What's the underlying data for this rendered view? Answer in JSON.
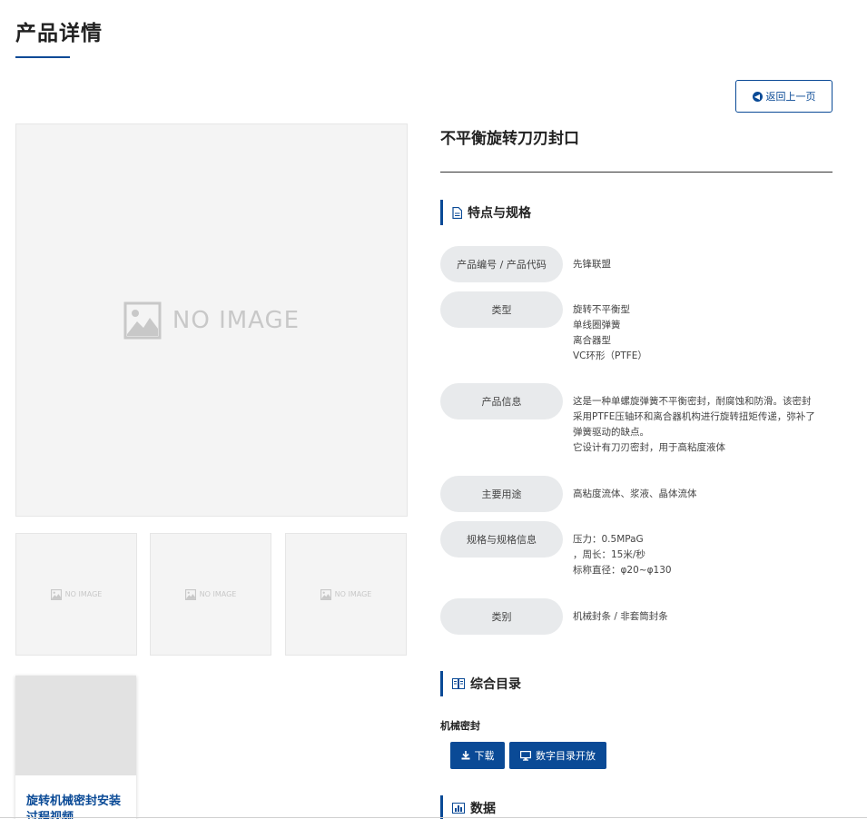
{
  "page": {
    "title": "产品详情"
  },
  "back_button": {
    "label": "返回上一页"
  },
  "gallery": {
    "main_placeholder": "NO IMAGE",
    "thumbnails": [
      "NO IMAGE",
      "NO IMAGE",
      "NO IMAGE"
    ]
  },
  "video": {
    "title": "旋转机械密封安装过程视频"
  },
  "product": {
    "name": "不平衡旋转刀刃封口"
  },
  "specs": {
    "section_title": "特点与规格",
    "rows": [
      {
        "label": "产品编号 / 产品代码",
        "values": [
          "先锋联盟"
        ]
      },
      {
        "label": "类型",
        "values": [
          "旋转不平衡型",
          "单线圈弹簧",
          "离合器型",
          "VC环形（PTFE）"
        ]
      },
      {
        "label": "产品信息",
        "values": [
          "这是一种单螺旋弹簧不平衡密封，耐腐蚀和防滑。该密封",
          "采用PTFE压轴环和离合器机构进行旋转扭矩传递，弥补了",
          "弹簧驱动的缺点。",
          "它设计有刀刃密封，用于高粘度液体"
        ]
      },
      {
        "label": "主要用途",
        "values": [
          "高粘度流体、浆液、晶体流体"
        ]
      },
      {
        "label": "规格与规格信息",
        "values": [
          "压力：0.5MPaG",
          "，周长：15米/秒",
          "标称直径：φ20~φ130"
        ]
      },
      {
        "label": "类别",
        "values": [
          "机械封条 / 非套筒封条"
        ]
      }
    ]
  },
  "catalog": {
    "section_title": "综合目录",
    "label": "机械密封",
    "download_label": "下载",
    "digital_label": "数字目录开放"
  },
  "data_section": {
    "section_title": "数据"
  }
}
